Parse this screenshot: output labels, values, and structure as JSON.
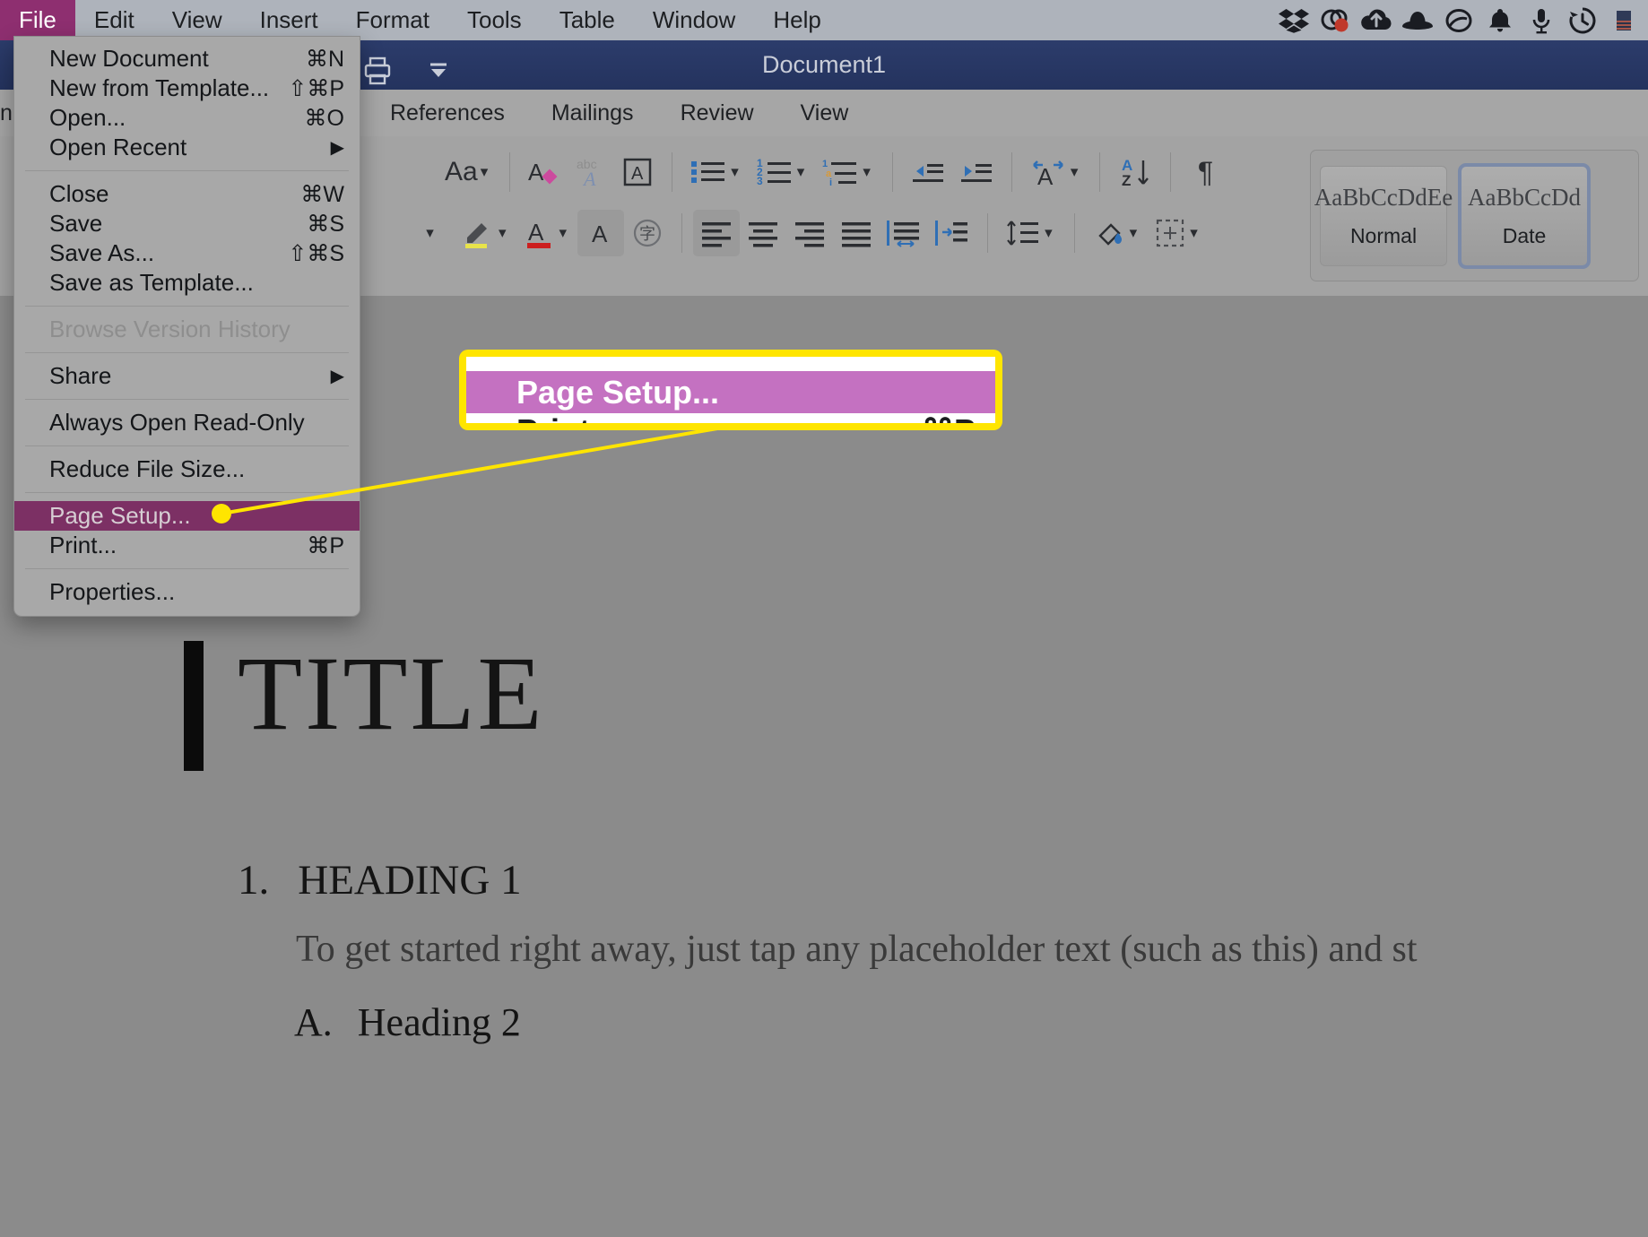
{
  "menubar": {
    "items": [
      {
        "label": "File",
        "active": true
      },
      {
        "label": "Edit",
        "active": false
      },
      {
        "label": "View",
        "active": false
      },
      {
        "label": "Insert",
        "active": false
      },
      {
        "label": "Format",
        "active": false
      },
      {
        "label": "Tools",
        "active": false
      },
      {
        "label": "Table",
        "active": false
      },
      {
        "label": "Window",
        "active": false
      },
      {
        "label": "Help",
        "active": false
      }
    ],
    "tray": [
      {
        "name": "dropbox-icon"
      },
      {
        "name": "cloud-sync-icon"
      },
      {
        "name": "cloud-upload-icon"
      },
      {
        "name": "bowler-hat-icon"
      },
      {
        "name": "circle-slash-icon"
      },
      {
        "name": "bell-icon"
      },
      {
        "name": "microphone-icon"
      },
      {
        "name": "time-machine-icon"
      },
      {
        "name": "flag-icon"
      }
    ]
  },
  "window": {
    "title": "Document1",
    "quick_access": [
      "print-icon",
      "customize-toolbar-icon"
    ]
  },
  "ribbon": {
    "tabs": [
      {
        "label": "ns",
        "partial": true
      },
      {
        "label": "References"
      },
      {
        "label": "Mailings"
      },
      {
        "label": "Review"
      },
      {
        "label": "View"
      }
    ],
    "row1_tools": [
      {
        "name": "change-case-icon",
        "glyph": "Aa",
        "caret": true
      },
      {
        "name": "text-effects-icon",
        "glyph": "A",
        "caret": false
      },
      {
        "name": "spelling-icon",
        "glyph": "abc",
        "caret": false
      },
      {
        "name": "text-box-icon",
        "glyph": "A",
        "caret": false
      },
      {
        "name": "bullet-list-icon",
        "glyph": "list",
        "caret": true
      },
      {
        "name": "numbered-list-icon",
        "glyph": "123",
        "caret": true
      },
      {
        "name": "multilevel-list-icon",
        "glyph": "1ai",
        "caret": true
      },
      {
        "name": "decrease-indent-icon",
        "glyph": "indent-left",
        "caret": false
      },
      {
        "name": "increase-indent-icon",
        "glyph": "indent-right",
        "caret": false
      },
      {
        "name": "text-direction-icon",
        "glyph": "A-arrows",
        "caret": true
      },
      {
        "name": "sort-icon",
        "glyph": "AZ",
        "caret": false
      },
      {
        "name": "show-formatting-marks-icon",
        "glyph": "¶",
        "caret": false
      }
    ],
    "row2_tools": [
      {
        "name": "font-size-caret-icon",
        "glyph": "",
        "caret": true
      },
      {
        "name": "highlight-color-icon",
        "glyph": "pen",
        "caret": true
      },
      {
        "name": "font-color-icon",
        "glyph": "A",
        "caret": true
      },
      {
        "name": "character-shading-icon",
        "glyph": "A",
        "caret": false
      },
      {
        "name": "phonetic-guide-icon",
        "glyph": "字",
        "caret": false
      },
      {
        "name": "align-left-icon",
        "glyph": "align-left",
        "caret": false
      },
      {
        "name": "align-center-icon",
        "glyph": "align-center",
        "caret": false
      },
      {
        "name": "align-right-icon",
        "glyph": "align-right",
        "caret": false
      },
      {
        "name": "justify-icon",
        "glyph": "justify",
        "caret": false
      },
      {
        "name": "distribute-icon",
        "glyph": "distribute",
        "caret": false
      },
      {
        "name": "indent-block-icon",
        "glyph": "indent-block",
        "caret": false
      },
      {
        "name": "line-spacing-icon",
        "glyph": "line-spacing",
        "caret": true
      },
      {
        "name": "shading-icon",
        "glyph": "bucket",
        "caret": true
      },
      {
        "name": "borders-icon",
        "glyph": "borders",
        "caret": true
      }
    ],
    "styles": [
      {
        "sample": "AaBbCcDdEe",
        "name": "Normal",
        "selected": false
      },
      {
        "sample": "AaBbCcDd",
        "name": "Date",
        "selected": true
      }
    ]
  },
  "file_menu": {
    "groups": [
      {
        "items": [
          {
            "label": "New Document",
            "shortcut": "⌘N"
          },
          {
            "label": "New from Template...",
            "shortcut": "⇧⌘P"
          },
          {
            "label": "Open...",
            "shortcut": "⌘O"
          },
          {
            "label": "Open Recent",
            "submenu": true
          }
        ]
      },
      {
        "items": [
          {
            "label": "Close",
            "shortcut": "⌘W"
          },
          {
            "label": "Save",
            "shortcut": "⌘S"
          },
          {
            "label": "Save As...",
            "shortcut": "⇧⌘S"
          },
          {
            "label": "Save as Template...",
            "shortcut": ""
          }
        ]
      },
      {
        "items": [
          {
            "label": "Browse Version History",
            "shortcut": "",
            "disabled": true
          }
        ]
      },
      {
        "items": [
          {
            "label": "Share",
            "submenu": true
          }
        ]
      },
      {
        "items": [
          {
            "label": "Always Open Read-Only",
            "shortcut": ""
          }
        ]
      },
      {
        "items": [
          {
            "label": "Reduce File Size...",
            "shortcut": ""
          }
        ]
      },
      {
        "items": [
          {
            "label": "Page Setup...",
            "shortcut": "",
            "highlight": true
          },
          {
            "label": "Print...",
            "shortcut": "⌘P"
          }
        ]
      },
      {
        "items": [
          {
            "label": "Properties...",
            "shortcut": ""
          }
        ]
      }
    ]
  },
  "callout": {
    "highlight_label": "Page Setup...",
    "next_label": "Print...",
    "next_shortcut": "⌘P",
    "border_color": "#ffe500",
    "highlight_color": "#c471c1"
  },
  "document": {
    "title": "TITLE",
    "heading1_number": "1.",
    "heading1_text": "HEADING 1",
    "body_text": "To get started right away, just tap any placeholder text (such as this) and st",
    "heading2_number": "A.",
    "heading2_text": "Heading 2"
  },
  "colors": {
    "accent_purple": "#8e2f70",
    "menu_highlight": "#7c3064",
    "callout_yellow": "#ffe500",
    "titlebar_blue": "#2c3c6b",
    "canvas_gray": "#8b8b8b"
  }
}
